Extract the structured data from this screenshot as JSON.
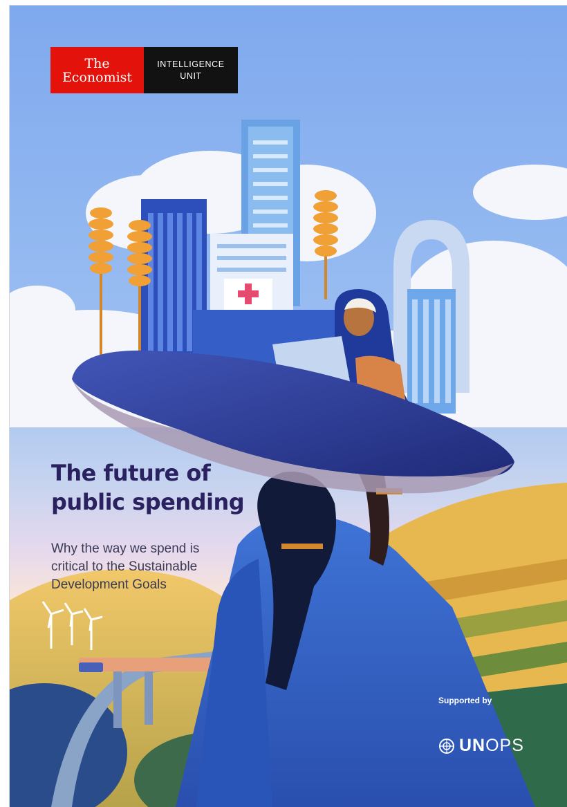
{
  "logo": {
    "line1": "The",
    "line2": "Economist",
    "unit_line1": "INTELLIGENCE",
    "unit_line2": "UNIT"
  },
  "title": {
    "line1": "The future of",
    "line2": "public spending"
  },
  "subtitle": {
    "line1": "Why the way we spend is",
    "line2": "critical to the Sustainable",
    "line3": "Development Goals"
  },
  "sponsor": {
    "label": "Supported by",
    "name_bold": "UN",
    "name_rest": "OPS",
    "icon": "un-emblem-icon"
  },
  "colors": {
    "economist_red": "#e3120b",
    "title_navy": "#2a2160",
    "sky": "#8fb3ec"
  }
}
